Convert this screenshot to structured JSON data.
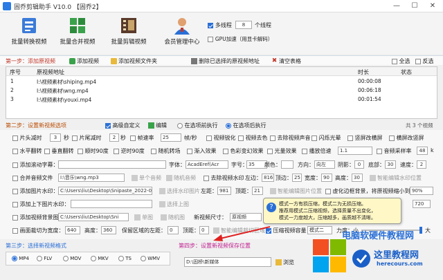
{
  "window": {
    "title": "固乔剪辑助手 V10.0 【固乔2】"
  },
  "toolbar": {
    "batch_convert": "批量转换视频",
    "batch_merge": "批量合并视频",
    "batch_edit": "批量剪辑视频",
    "member_center": "会员管理中心",
    "multithread_label": "多线程",
    "thread_count": "8",
    "thread_unit": "个线程",
    "gpu_label": "GPU加速（用显卡解码）"
  },
  "step1": {
    "label": "第一步：添加原视频",
    "add_video": "添加视频",
    "add_folder": "添加视频文件夹",
    "delete_selected": "删除已选择的原视频地址",
    "clear_table": "清空表格",
    "select_all": "全选",
    "invert": "反选"
  },
  "table": {
    "headers": {
      "index": "序号",
      "path": "原视频地址",
      "duration": "时长",
      "status": "状态"
    },
    "rows": [
      {
        "index": "1",
        "path": "I:\\视频素材\\shiping.mp4",
        "duration": "00:00:08"
      },
      {
        "index": "2",
        "path": "I:\\视频素材\\wng.mp4",
        "duration": "00:06:18"
      },
      {
        "index": "3",
        "path": "I:\\视频素材\\youxi.mp4",
        "duration": "00:01:54"
      }
    ],
    "footer": "共 3 个视频"
  },
  "step2": {
    "label": "第二步：设置新视频选项",
    "advanced": "高级自定义",
    "edit": "编辑",
    "before": "在选项前执行",
    "after": "在选项后执行",
    "r1": {
      "head_cut": "片头减时",
      "head_val": "3",
      "sec1": "秒",
      "tail_cut": "片尾减时",
      "tail_val": "2",
      "sec2": "秒",
      "fps": "帧速率",
      "fps_val": "25",
      "fps_unit": "帧/秒",
      "optimize": "视频锐化",
      "denoise": "视频去色",
      "mute": "去除视频声音",
      "flash": "闪烁光晕",
      "vertical_blur": "竖屏改横屏",
      "horizontal_blur": "横屏改竖屏"
    },
    "r2": {
      "hflip": "水平翻转",
      "vflip": "垂直翻转",
      "cw90": "顺时90度",
      "ccw90": "逆时90度",
      "random": "随机转场",
      "fade": "渐入效果",
      "color": "色彩变幻效果",
      "light": "光量效果",
      "speed": "播放倍速",
      "speed_val": "1.1",
      "sample": "音频采样率",
      "sample_val": "48",
      "sample_unit": "k"
    },
    "r3": {
      "subtitle": "添加滚动字幕：",
      "font": "字体：",
      "font_val": "AcadEref(Acr",
      "size": "字号：",
      "size_val": "35",
      "color": "颜色：",
      "dir": "方向：",
      "dir_val": "向左",
      "shadow": "阴影：",
      "shadow_val": "0",
      "bottom": "底部：",
      "bottom_val": "30",
      "speed": "速度：",
      "speed_val": "2"
    },
    "r4": {
      "merge_audio": "合并音频文件",
      "audio_val": "I:\\音乐\\wng.mp3",
      "single_audio": "单个音频",
      "random_audio": "随机音频",
      "remove_watermark": "去除视频水印",
      "left": "左边：",
      "left_val": "816",
      "top": "顶边：",
      "top_val": "25",
      "width": "宽度：",
      "width_val": "90",
      "height": "高度：",
      "height_val": "30",
      "smart": "智能编辑水印位置"
    },
    "r5": {
      "add_image": "添加图片水印：",
      "image_val": "C:\\Users\\liu\\Desktop\\Snipaste_2022-0",
      "choose": "选择水印图片",
      "left": "左距：",
      "left_val": "981",
      "top": "顶距：",
      "top_val": "21",
      "smart": "智能编辑图片位置",
      "virtual": "虚化边框背景，将原视频缩小到",
      "virtual_val": "90%"
    },
    "r6": {
      "add_topbottom": "添加上下图片水印：",
      "choose": "选择上图",
      "bottom_val": "720"
    },
    "r7": {
      "add_bg": "添加视频背景图片",
      "bg_val": "C:\\Users\\liu\\Desktop\\Sni",
      "single": "单图",
      "random": "随机图",
      "size": "新视频尺寸：",
      "size_val": "原视频"
    },
    "r8": {
      "crop": "画面裁切为宽度：",
      "crop_w": "640",
      "height": "高度：",
      "height_val": "360",
      "keep": "保留区域的左距：",
      "left_val": "0",
      "top": "顶距：",
      "top_val": "0",
      "smart": "智能编辑裁切区域",
      "compress": "压缩视频容量",
      "mode": "模式二",
      "force": "力度：",
      "small": "小",
      "large": "大"
    }
  },
  "tooltip": {
    "line1": "模式一方有损压缩，模式二为无损压缩。",
    "line2": "推荐用模式二压缩视频，选择质量不出变化，",
    "line3": "模式一力度越大，压缩越多，画质越不清晰。"
  },
  "step3": {
    "label": "第三步：选择新视频格式",
    "formats": [
      "MP4",
      "FLV",
      "MOV",
      "MKV",
      "TS",
      "WMV"
    ]
  },
  "step4": {
    "label": "第四步：设置新视频保存位置",
    "path": "D:\\固桥\\新媒体",
    "browse": "浏览"
  },
  "watermark": {
    "text1": "电脑软硬件教程网",
    "text2": "这里教程网",
    "text3": "herecours.com"
  },
  "colors": {
    "accent": "#2a6fd6",
    "step": "#c0392b",
    "tooltip_bg": "#fff8c6"
  }
}
